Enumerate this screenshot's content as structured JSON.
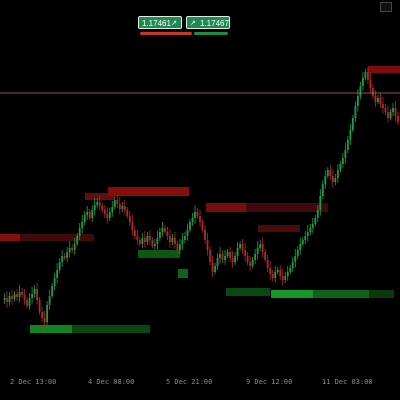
{
  "trade_panel": {
    "sell_price": "1.17461",
    "sell_icon": "arrow-icon",
    "buy_price": "1.17467",
    "buy_icon": "arrow-icon",
    "sell_color": "#1d8a52",
    "sell_bar_color": "#c0392b",
    "buy_bar_color": "#1e8a4a"
  },
  "colors": {
    "background": "#000000",
    "up_candle": "#1f9e4a",
    "down_candle": "#b5282a",
    "supply_zone": "#8b1010",
    "demand_zone": "#137a1f",
    "price_line": "#c07050"
  },
  "x_axis_labels": [
    "2 Dec 13:00",
    "4 Dec 08:00",
    "5 Dec 21:00",
    "9 Dec 12:00",
    "11 Dec 03:00"
  ],
  "chart_data": {
    "type": "candlestick",
    "x_labels": [
      "2 Dec 13:00",
      "4 Dec 08:00",
      "5 Dec 21:00",
      "9 Dec 12:00",
      "11 Dec 03:00"
    ],
    "current_price": 1.17461,
    "grid": false
  }
}
